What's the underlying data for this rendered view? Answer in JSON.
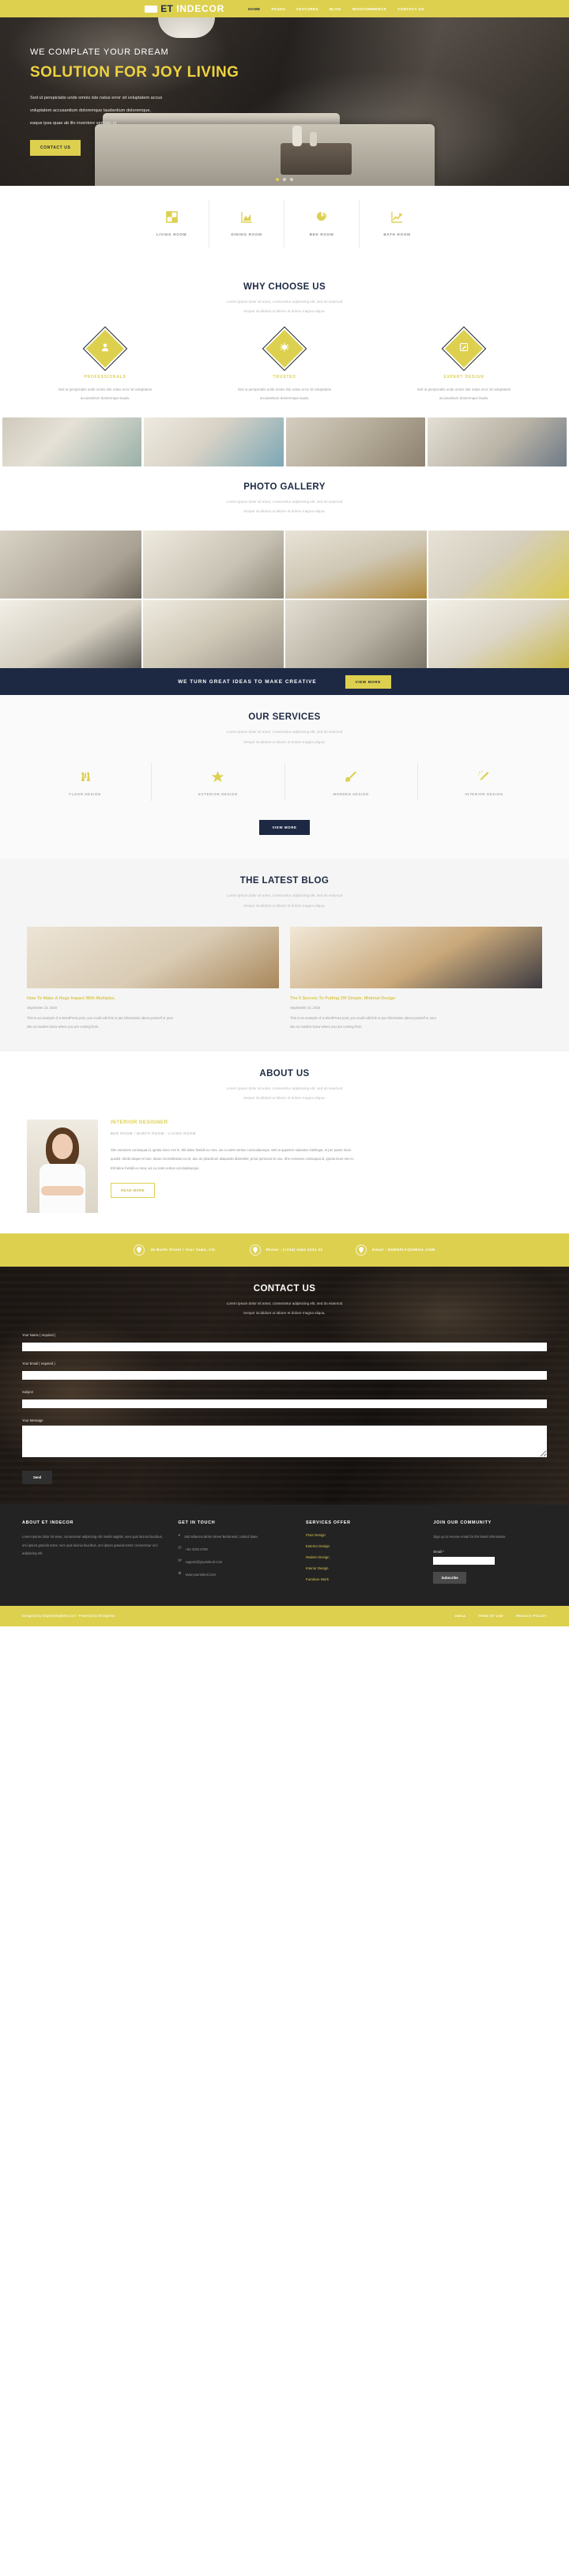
{
  "header": {
    "brand_et": "ET",
    "brand_name": "INDECOR",
    "brand_icon": "bed-icon",
    "nav": [
      {
        "label": "HOME",
        "active": true
      },
      {
        "label": "PAGES",
        "active": false
      },
      {
        "label": "FEATURES",
        "active": false
      },
      {
        "label": "BLOG",
        "active": false
      },
      {
        "label": "WOOCOMMERCE",
        "active": false
      },
      {
        "label": "CONTACT US",
        "active": false
      }
    ]
  },
  "hero": {
    "subtitle": "WE COMPLATE YOUR DREAM",
    "title": "SOLUTION FOR JOY LIVING",
    "paragraph_line1": "Sed ut perspiciatis unde omnis iste natus error sit voluptatem accus",
    "paragraph_line2": "voluptatem accusantium doloremque laudantium doloremque,",
    "paragraph_line3": "eaque ipsa quae ab illo inventore veritatis et",
    "button": "CONTACT US"
  },
  "features": [
    {
      "label": "LIVING ROOM",
      "icon": "grid-squares-icon"
    },
    {
      "label": "DINING ROOM",
      "icon": "area-chart-icon"
    },
    {
      "label": "BED ROOM",
      "icon": "pie-chart-icon"
    },
    {
      "label": "BATH ROOM",
      "icon": "line-chart-up-icon"
    }
  ],
  "why_choose": {
    "title": "WHY CHOOSE US",
    "desc_line1": "Lorem ipsum dolor sit amet, consectetur adipisicing elit, sed do eiusmod",
    "desc_line2": "tempor incididunt ut labore et dolore magna aliqua.",
    "columns": [
      {
        "name": "PROFESSIONALS",
        "icon": "user-icon",
        "text_line1": "Sed ut perspiciatis unde omnis iste natus error sit voluptatem",
        "text_line2": "accusantium doloremque laudа."
      },
      {
        "name": "TRUSTED",
        "icon": "sunburst-icon",
        "text_line1": "Sed ut perspiciatis unde omnis iste natus error sit voluptatem",
        "text_line2": "accusantium doloremque laudа."
      },
      {
        "name": "EXPERT DESIGN",
        "icon": "pencil-edit-icon",
        "text_line1": "Sed ut perspiciatis unde omnis iste natus error sit voluptatem",
        "text_line2": "accusantium doloremque laudа."
      }
    ]
  },
  "gallery": {
    "title": "PHOTO GALLERY",
    "desc_line1": "Lorem ipsum dolor sit amet, consectetur adipisicing elit, sed do eiusmod",
    "desc_line2": "tempor incididunt ut labore et dolore magna aliqua."
  },
  "cta": {
    "text": "WE TURN GREAT IDEAS TO MAKE CREATIVE",
    "button": "VIEW MORE"
  },
  "services": {
    "title": "OUR SERVICES",
    "desc_line1": "Lorem ipsum dolor sit amet, consectetur adipisicing elit, sed do eiusmod",
    "desc_line2": "tempor incididunt ut labore et dolore magna aliqua.",
    "items": [
      {
        "label": "FLOOR DESIGN",
        "icon": "binoculars-icon"
      },
      {
        "label": "EXTERIOR DESIGN",
        "icon": "star-icon"
      },
      {
        "label": "MORDEN DESIGN",
        "icon": "paint-brush-icon"
      },
      {
        "label": "INTERIOR DESIGN",
        "icon": "magic-wand-icon"
      }
    ],
    "more_button": "VIEW MORE"
  },
  "blog": {
    "title": "THE LATEST BLOG",
    "desc_line1": "Lorem ipsum dolor sit amet, consectetur adipisicing elit, sed do eiusmod",
    "desc_line2": "tempor incididunt ut labore et dolore magna aliqua.",
    "posts": [
      {
        "title": "How To Make A Huge Impact With Multiples",
        "date": "September 23, 2016",
        "excerpt_line1": "This is an example of a WordPress post, you could edit this to put information about yourself or your",
        "excerpt_line2": "site so readers know where you are coming from."
      },
      {
        "title": "The 5 Secrets To Pulling Off Simple, Minimal Design",
        "date": "September 23, 2016",
        "excerpt_line1": "This is an example of a WordPress post, you could edit this to put information about yourself or your",
        "excerpt_line2": "site so readers know where you are coming from."
      }
    ]
  },
  "about": {
    "title": "ABOUT US",
    "desc_line1": "Lorem ipsum dolor sit amet, consectetur adipisicing elit, sed do eiusmod",
    "desc_line2": "tempor incididunt ut labore et dolore magna aliqua.",
    "role": "INTERIOR DESIGNER",
    "meta": "BED ROOM / BARTH ROOM - LIVING ROOM",
    "text_line1": "She nonumes consequat id, ignota iriure mei in. Elit latine fastidii ex mea, ius cu solet veritus concludaturque. Mel at appetere salutatus intellegat, ut per posse iriure",
    "text_line2": "quodsi. Morbi aliquet et tum, duam reconstituitas ea vit, duo an phaedrum aliquando dissentiet, prout persecuti te usu. She nonumes consequat id, ignota iriure mei in.",
    "text_line3": "Elit latine fastidii ex mea, ius cu solet veritus concludaturque.",
    "button": "READ MORE"
  },
  "contact_strip": [
    {
      "icon": "map-pin-icon",
      "text": "25 North Street / Your Town, CO."
    },
    {
      "icon": "map-pin-icon",
      "text": "Phone : (+314) 0454 3234 23"
    },
    {
      "icon": "map-pin-icon",
      "text": "Email : NOREPLY@GMAIL.COM"
    }
  ],
  "contact_form": {
    "title": "CONTACT US",
    "desc_line1": "Lorem ipsum dolor sit amet, consectetur adipisicing elit, sed do eiusmod",
    "desc_line2": "tempor incididunt ut labore et dolore magna aliqua.",
    "fields": [
      {
        "label": "Your Name ( required )",
        "value": ""
      },
      {
        "label": "Your Email ( required )",
        "value": ""
      },
      {
        "label": "Subject",
        "value": ""
      },
      {
        "label": "Your Message",
        "value": ""
      }
    ],
    "send_button": "Send"
  },
  "footer": {
    "about": {
      "heading": "ABOUT ET INDECOR",
      "text": "Lorem ipsum dolor sit amet, consectetur adipiscing elit. Morbi sagittis, sem quis lacinia faucibus, orci ipsum gravida tortor, sem quis lacinia faucibus, orci ipsum gravida tortor consectetur orci adipiscing elit."
    },
    "touch": {
      "heading": "GET IN TOUCH",
      "lines": [
        {
          "icon": "map-pin-icon",
          "text": "262 Milacina Moris Street Behansed, United State."
        },
        {
          "icon": "phone-icon",
          "text": "+84 3333 6789"
        },
        {
          "icon": "envelope-icon",
          "text": "support@yoursiteurl.com"
        },
        {
          "icon": "globe-icon",
          "text": "www.yoursiteurl.com"
        }
      ]
    },
    "services": {
      "heading": "SERVICES OFFER",
      "links": [
        "Floor Design",
        "Exterior Design",
        "Modern Design",
        "Interior Design",
        "Furniture Work"
      ]
    },
    "community": {
      "heading": "JOIN OUR COMMUNITY",
      "text": "Sign up to receive email for the latest information.",
      "email_label": "Email *",
      "email_value": "",
      "subscribe_button": "Subscribe"
    }
  },
  "copyright": {
    "text": "Designed by Enginetemplates.com - Powered by Wordpress",
    "links": [
      "DMCA",
      "TERM OF USE",
      "PRIVACY POLICY"
    ]
  },
  "colors": {
    "accent": "#ddd04f",
    "navy": "#1d2943",
    "dark": "#232323"
  }
}
